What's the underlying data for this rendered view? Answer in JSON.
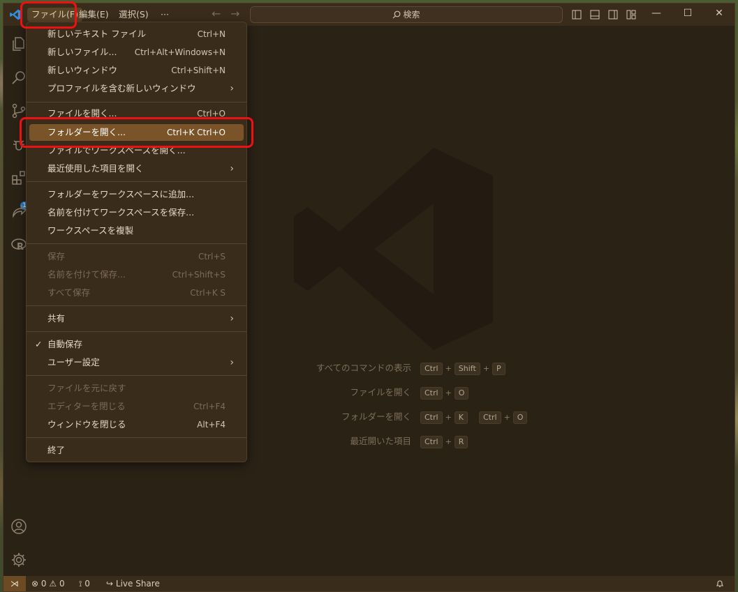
{
  "titlebar": {
    "menus": [
      "ファイル(F)",
      "編集(E)",
      "選択(S)",
      "···"
    ],
    "search_placeholder": "検索",
    "window_controls": [
      "minimize",
      "maximize",
      "close"
    ]
  },
  "file_menu": {
    "items": [
      {
        "label": "新しいテキスト ファイル",
        "shortcut": "Ctrl+N"
      },
      {
        "label": "新しいファイル...",
        "shortcut": "Ctrl+Alt+Windows+N"
      },
      {
        "label": "新しいウィンドウ",
        "shortcut": "Ctrl+Shift+N"
      },
      {
        "label": "プロファイルを含む新しいウィンドウ",
        "shortcut": ""
      },
      {
        "label": "ファイルを開く...",
        "shortcut": "Ctrl+O"
      },
      {
        "label": "フォルダーを開く...",
        "shortcut": "Ctrl+K Ctrl+O"
      },
      {
        "label": "ファイルでワークスペースを開く...",
        "shortcut": ""
      },
      {
        "label": "最近使用した項目を開く",
        "shortcut": ""
      },
      {
        "label": "フォルダーをワークスペースに追加...",
        "shortcut": ""
      },
      {
        "label": "名前を付けてワークスペースを保存...",
        "shortcut": ""
      },
      {
        "label": "ワークスペースを複製",
        "shortcut": ""
      },
      {
        "label": "保存",
        "shortcut": "Ctrl+S"
      },
      {
        "label": "名前を付けて保存...",
        "shortcut": "Ctrl+Shift+S"
      },
      {
        "label": "すべて保存",
        "shortcut": "Ctrl+K S"
      },
      {
        "label": "共有",
        "shortcut": ""
      },
      {
        "label": "自動保存",
        "shortcut": ""
      },
      {
        "label": "ユーザー設定",
        "shortcut": ""
      },
      {
        "label": "ファイルを元に戻す",
        "shortcut": ""
      },
      {
        "label": "エディターを閉じる",
        "shortcut": "Ctrl+F4"
      },
      {
        "label": "ウィンドウを閉じる",
        "shortcut": "Alt+F4"
      },
      {
        "label": "終了",
        "shortcut": ""
      }
    ]
  },
  "welcome": {
    "show_all_commands": "すべてのコマンドの表示",
    "open_file": "ファイルを開く",
    "open_folder": "フォルダーを開く",
    "recent": "最近開いた項目",
    "keys": {
      "ctrl": "Ctrl",
      "shift": "Shift",
      "p": "P",
      "o": "O",
      "k": "K",
      "r": "R",
      "plus": "+"
    }
  },
  "activitybar": {
    "extensions_badge": "1"
  },
  "statusbar": {
    "errors": "0",
    "warnings": "0",
    "ports": "0",
    "live_share": "Live Share"
  },
  "colors": {
    "accent": "#7a5428",
    "highlight_box": "#ee1111",
    "badge": "#1b7fd6"
  }
}
